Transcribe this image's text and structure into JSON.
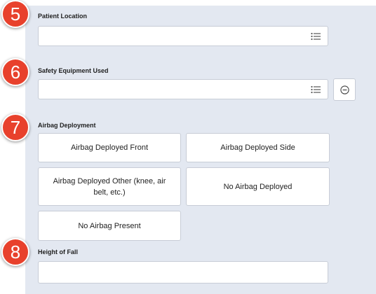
{
  "sections": {
    "patient_location": {
      "step": "5",
      "label": "Patient Location",
      "value": ""
    },
    "safety_equipment": {
      "step": "6",
      "label": "Safety Equipment Used",
      "value": ""
    },
    "airbag": {
      "step": "7",
      "label": "Airbag Deployment",
      "options": [
        "Airbag Deployed Front",
        "Airbag Deployed Side",
        "Airbag Deployed Other (knee, air belt, etc.)",
        "No Airbag Deployed",
        "No Airbag Present"
      ]
    },
    "height_of_fall": {
      "step": "8",
      "label": "Height of Fall",
      "value": ""
    }
  },
  "colors": {
    "panel": "#e3e8f1",
    "badge": "#e8412c",
    "border": "#c7ccd6"
  },
  "icons": {
    "list": "list-icon",
    "remove": "minus-circle-icon"
  }
}
